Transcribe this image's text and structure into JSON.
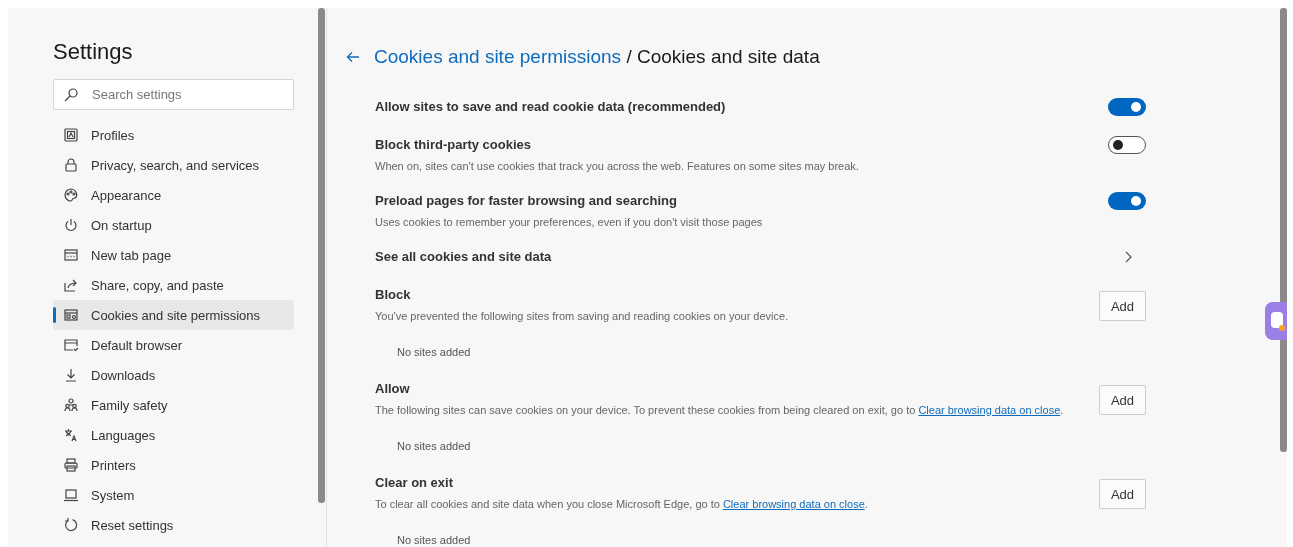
{
  "sidebar": {
    "title": "Settings",
    "search": {
      "placeholder": "Search settings"
    },
    "items": [
      {
        "label": "Profiles",
        "selected": false
      },
      {
        "label": "Privacy, search, and services",
        "selected": false
      },
      {
        "label": "Appearance",
        "selected": false
      },
      {
        "label": "On startup",
        "selected": false
      },
      {
        "label": "New tab page",
        "selected": false
      },
      {
        "label": "Share, copy, and paste",
        "selected": false
      },
      {
        "label": "Cookies and site permissions",
        "selected": true
      },
      {
        "label": "Default browser",
        "selected": false
      },
      {
        "label": "Downloads",
        "selected": false
      },
      {
        "label": "Family safety",
        "selected": false
      },
      {
        "label": "Languages",
        "selected": false
      },
      {
        "label": "Printers",
        "selected": false
      },
      {
        "label": "System",
        "selected": false
      },
      {
        "label": "Reset settings",
        "selected": false
      }
    ]
  },
  "content": {
    "breadcrumb": {
      "parent": "Cookies and site permissions",
      "separator": "/",
      "current": "Cookies and site data"
    },
    "rows": [
      {
        "kind": "toggle",
        "title": "Allow sites to save and read cookie data (recommended)",
        "on": true
      },
      {
        "kind": "toggle",
        "title": "Block third-party cookies",
        "description": "When on, sites can't use cookies that track you across the web. Features on some sites may break.",
        "on": false
      },
      {
        "kind": "toggle",
        "title": "Preload pages for faster browsing and searching",
        "description": "Uses cookies to remember your preferences, even if you don't visit those pages",
        "on": true
      },
      {
        "kind": "link",
        "title": "See all cookies and site data"
      },
      {
        "kind": "list",
        "title": "Block",
        "description": "You've prevented the following sites from saving and reading cookies on your device.",
        "button": "Add",
        "empty": "No sites added"
      },
      {
        "kind": "list",
        "title": "Allow",
        "description": "The following sites can save cookies on your device. To prevent these cookies from being cleared on exit, go to ",
        "link": "Clear browsing data on close",
        "after": ".",
        "button": "Add",
        "empty": "No sites added"
      },
      {
        "kind": "list",
        "title": "Clear on exit",
        "description": "To clear all cookies and site data when you close Microsoft Edge, go to ",
        "link": "Clear browsing data on close",
        "after": ".",
        "button": "Add",
        "empty": "No sites added"
      }
    ]
  }
}
